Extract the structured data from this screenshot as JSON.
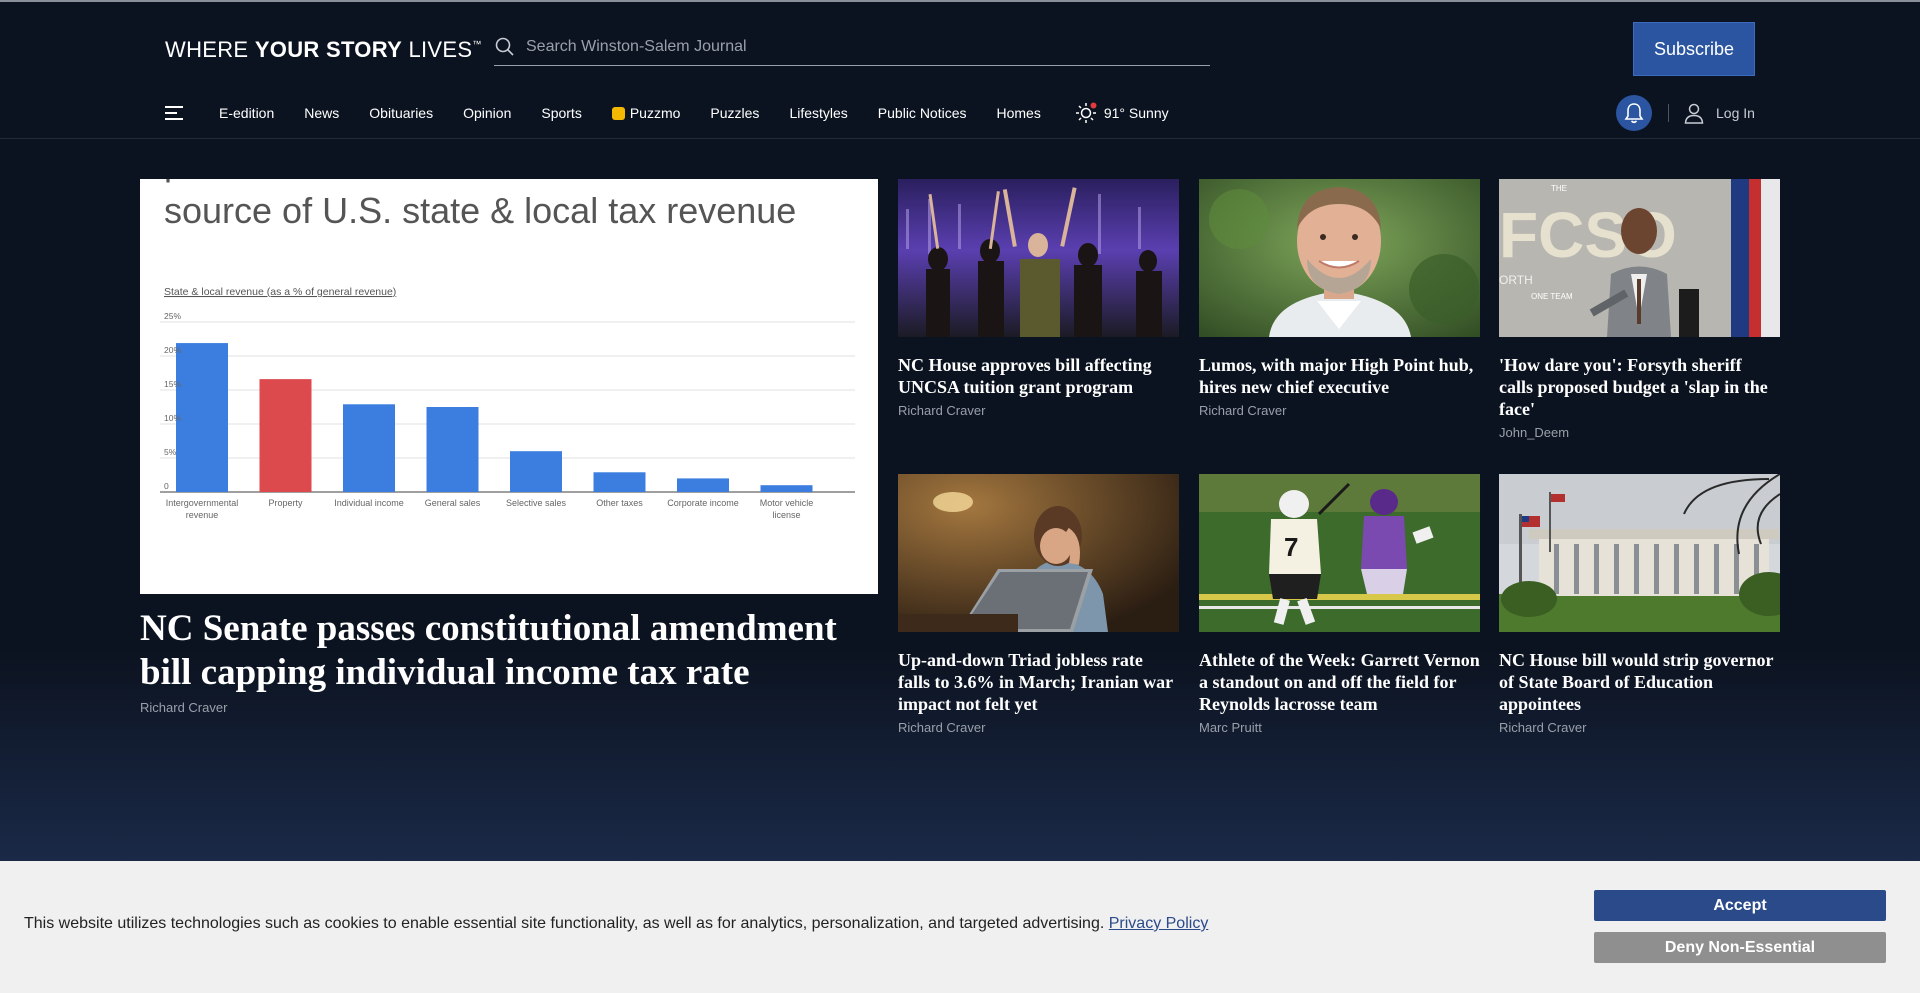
{
  "header": {
    "logo_light": "WHERE ",
    "logo_bold": "YOUR STORY",
    "logo_light2": " LIVES",
    "logo_tm": "™",
    "search_placeholder": "Search Winston-Salem Journal",
    "subscribe_label": "Subscribe",
    "login_label": "Log In"
  },
  "nav": {
    "items": [
      "E-edition",
      "News",
      "Obituaries",
      "Opinion",
      "Sports",
      "Puzzmo",
      "Puzzles",
      "Lifestyles",
      "Public Notices",
      "Homes"
    ],
    "weather": "91° Sunny"
  },
  "lead": {
    "image_heading": "source of U.S. state & local tax revenue",
    "image_chart_caption": "State & local revenue (as a % of general revenue)",
    "title": "NC Senate passes constitutional amendment bill capping individual income tax rate",
    "author": "Richard Craver"
  },
  "chart_data": {
    "type": "bar",
    "title": "source of U.S. state & local tax revenue",
    "ylabel": "State & local revenue (as a % of general revenue)",
    "categories": [
      "Intergovernmental revenue",
      "Property",
      "Individual income",
      "General sales",
      "Selective sales",
      "Other taxes",
      "Corporate income",
      "Motor vehicle license"
    ],
    "category_lines": [
      [
        "Intergovernmental",
        "revenue"
      ],
      [
        "Property"
      ],
      [
        "Individual income"
      ],
      [
        "General sales"
      ],
      [
        "Selective sales"
      ],
      [
        "Other taxes"
      ],
      [
        "Corporate income"
      ],
      [
        "Motor vehicle",
        "license"
      ]
    ],
    "values": [
      21.9,
      16.6,
      12.9,
      12.5,
      6.0,
      2.9,
      2.0,
      1.0
    ],
    "highlight_index": 1,
    "colors": {
      "bar": "#3c7ee0",
      "highlight": "#dc4a4e"
    },
    "yticks": [
      "0",
      "5%",
      "10%",
      "15%",
      "20%",
      "25%"
    ],
    "ylim": [
      0,
      25
    ],
    "grid": true
  },
  "cards": [
    {
      "title": "NC House approves bill affecting UNCSA tuition grant program",
      "author": "Richard Craver",
      "image": "dancers"
    },
    {
      "title": "Lumos, with major High Point hub, hires new chief executive",
      "author": "Richard Craver",
      "image": "portrait"
    },
    {
      "title": "'How dare you': Forsyth sheriff calls proposed budget a 'slap in the face'",
      "author": "John_Deem",
      "image": "sheriff",
      "image_text": "THE",
      "image_text2": "ONE TEAM"
    },
    {
      "title": "Up-and-down Triad jobless rate falls to 3.6% in March; Iranian war impact not felt yet",
      "author": "Richard Craver",
      "image": "worried-woman"
    },
    {
      "title": "Athlete of the Week: Garrett Vernon a standout on and off the field for Reynolds lacrosse team",
      "author": "Marc Pruitt",
      "image": "lacrosse",
      "image_text": "7"
    },
    {
      "title": "NC House bill would strip governor of State Board of Education appointees",
      "author": "Richard Craver",
      "image": "legislative-building"
    }
  ],
  "cookie": {
    "text": "This website utilizes technologies such as cookies to enable essential site functionality, as well as for analytics, personalization, and targeted advertising. ",
    "link": "Privacy Policy",
    "accept": "Accept",
    "deny": "Deny Non-Essential"
  },
  "colors": {
    "accent": "#2b55a0",
    "background": "#0c1320",
    "accept": "#2b4a8a",
    "deny": "#8f8f8f"
  }
}
